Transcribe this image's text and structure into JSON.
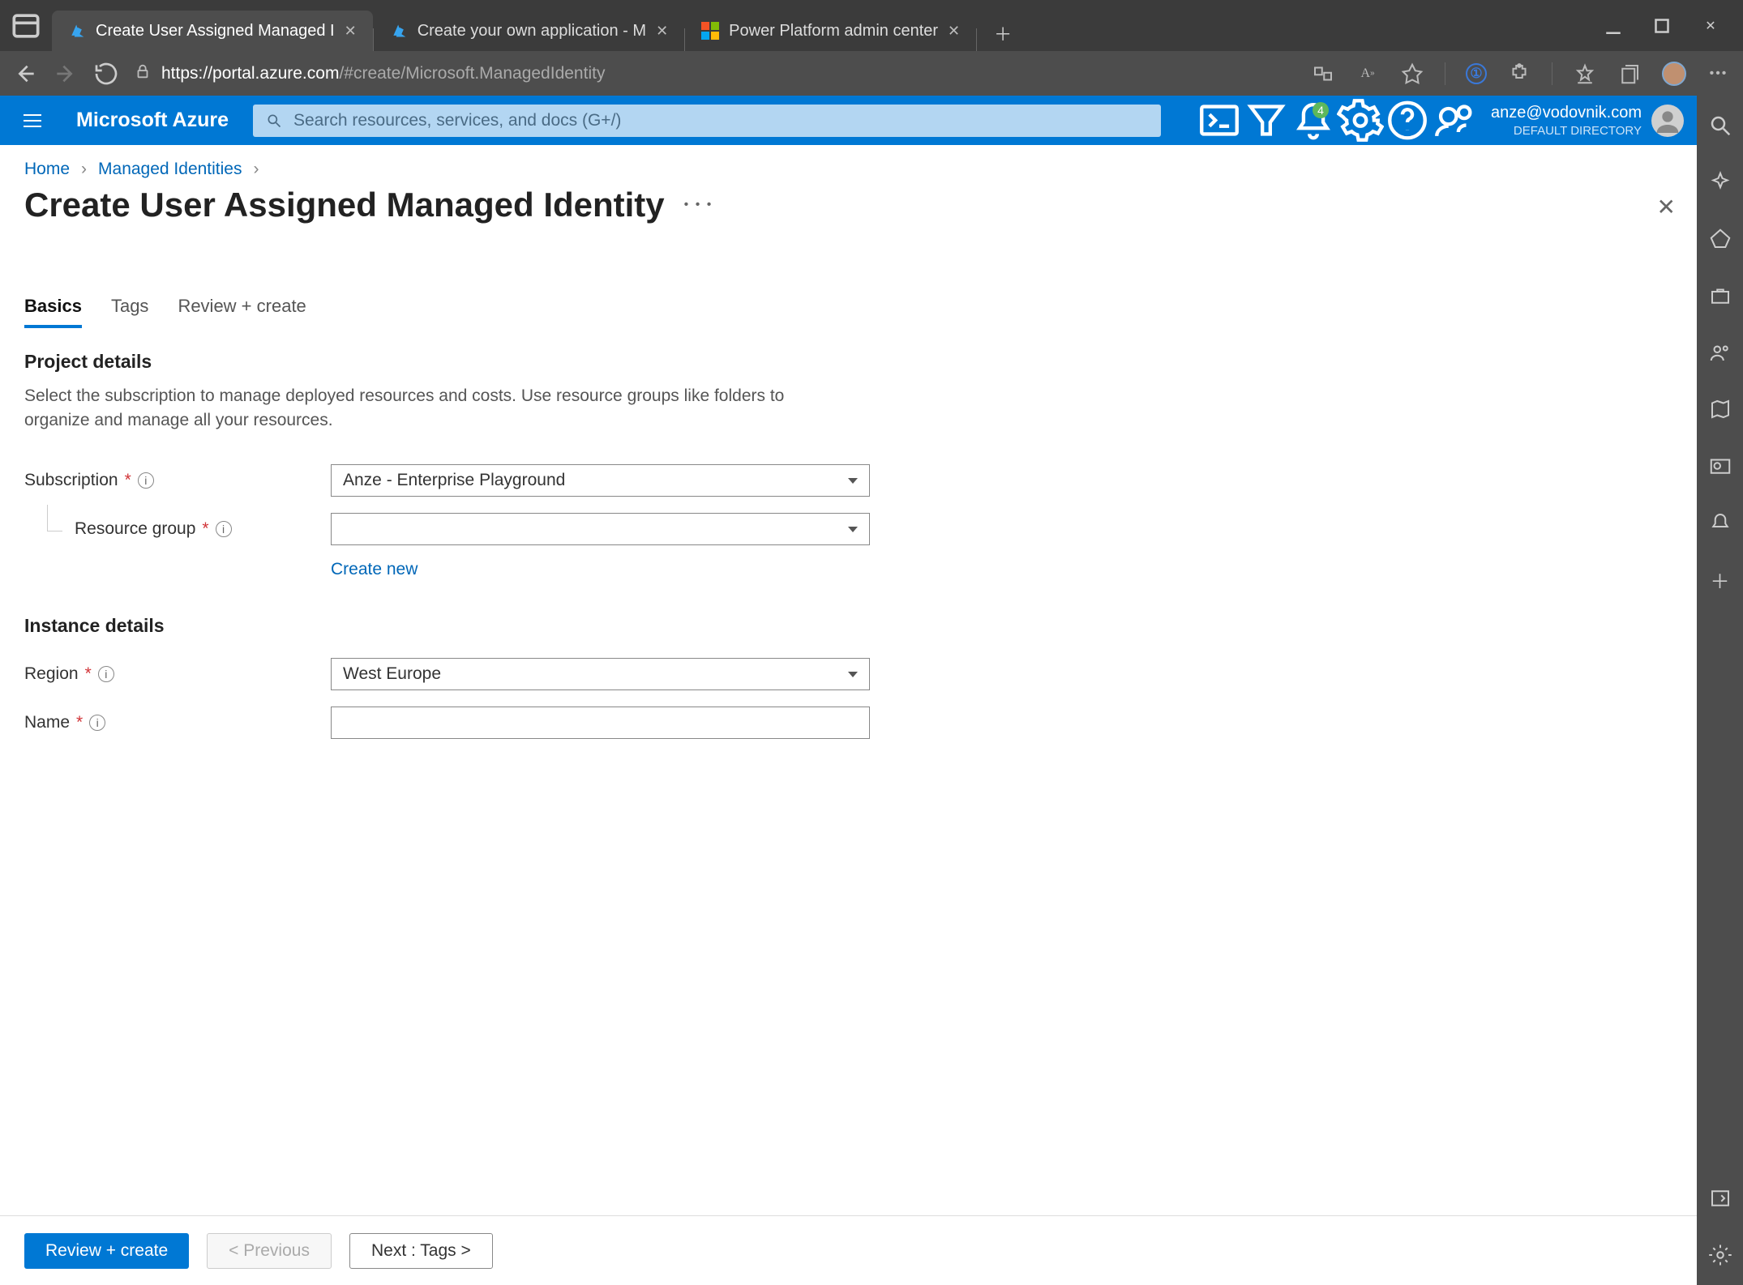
{
  "browser": {
    "tabs": [
      {
        "title": "Create User Assigned Managed I",
        "active": true,
        "favicon": "azure"
      },
      {
        "title": "Create your own application - M",
        "active": false,
        "favicon": "azure"
      },
      {
        "title": "Power Platform admin center",
        "active": false,
        "favicon": "microsoft"
      }
    ],
    "url_host": "https://portal.azure.com",
    "url_path": "/#create/Microsoft.ManagedIdentity"
  },
  "portal": {
    "brand": "Microsoft Azure",
    "search_placeholder": "Search resources, services, and docs (G+/)",
    "notification_count": "4",
    "account_email": "anze@vodovnik.com",
    "account_directory": "DEFAULT DIRECTORY"
  },
  "breadcrumb": {
    "home": "Home",
    "parent": "Managed Identities"
  },
  "page_title": "Create User Assigned Managed Identity",
  "tabs": {
    "basics": "Basics",
    "tags": "Tags",
    "review": "Review + create"
  },
  "sections": {
    "project": {
      "heading": "Project details",
      "helper": "Select the subscription to manage deployed resources and costs. Use resource groups like folders to organize and manage all your resources.",
      "subscription_label": "Subscription",
      "subscription_value": "Anze - Enterprise Playground",
      "resource_group_label": "Resource group",
      "resource_group_value": "",
      "create_new": "Create new"
    },
    "instance": {
      "heading": "Instance details",
      "region_label": "Region",
      "region_value": "West Europe",
      "name_label": "Name",
      "name_value": ""
    }
  },
  "footer": {
    "review_create": "Review + create",
    "previous": "< Previous",
    "next": "Next : Tags >"
  }
}
